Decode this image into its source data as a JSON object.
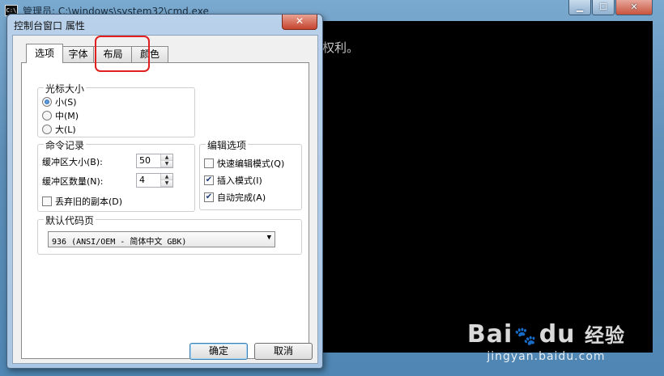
{
  "cmd_window": {
    "title": "管理员: C:\\windows\\system32\\cmd.exe",
    "icon_text": "C:\\",
    "min": "▁",
    "max": "☐",
    "close": "✕",
    "console_line": "权利。"
  },
  "dialog": {
    "title": "控制台窗口 属性",
    "close": "✕",
    "tabs": [
      "选项",
      "字体",
      "布局",
      "颜色"
    ],
    "cursor_size": {
      "legend": "光标大小",
      "options": [
        "小(S)",
        "中(M)",
        "大(L)"
      ],
      "selected": 0
    },
    "command_history": {
      "legend": "命令记录",
      "buffer_size_label": "缓冲区大小(B):",
      "buffer_size_value": "50",
      "buffer_count_label": "缓冲区数量(N):",
      "buffer_count_value": "4",
      "discard_label": "丢弃旧的副本(D)",
      "discard_checked": false
    },
    "edit_options": {
      "legend": "编辑选项",
      "items": [
        {
          "label": "快速编辑模式(Q)",
          "checked": false
        },
        {
          "label": "插入模式(I)",
          "checked": true
        },
        {
          "label": "自动完成(A)",
          "checked": true
        }
      ]
    },
    "codepage": {
      "legend": "默认代码页",
      "value": "936   (ANSI/OEM - 简体中文 GBK)"
    },
    "ok": "确定",
    "cancel": "取消"
  },
  "watermark": {
    "brand": "Bai",
    "brand2": "du",
    "brand3": "经验",
    "url": "jingyan.baidu.com"
  }
}
